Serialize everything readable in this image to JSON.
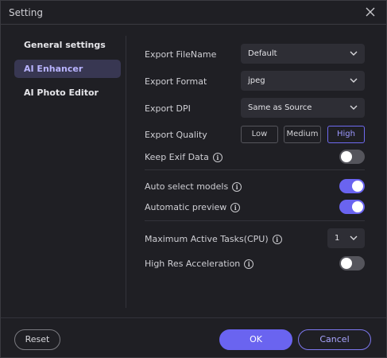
{
  "window": {
    "title": "Setting"
  },
  "sidebar": {
    "items": [
      {
        "label": "General settings"
      },
      {
        "label": "AI Enhancer"
      },
      {
        "label": "AI Photo Editor"
      }
    ]
  },
  "settings": {
    "export_filename": {
      "label": "Export FileName",
      "value": "Default"
    },
    "export_format": {
      "label": "Export Format",
      "value": "jpeg"
    },
    "export_dpi": {
      "label": "Export DPI",
      "value": "Same as Source"
    },
    "export_quality": {
      "label": "Export Quality",
      "options": [
        "Low",
        "Medium",
        "High"
      ],
      "selected": "High"
    },
    "keep_exif": {
      "label": "Keep Exif Data",
      "enabled": false
    },
    "auto_select_models": {
      "label": "Auto select models",
      "enabled": true
    },
    "automatic_preview": {
      "label": "Automatic preview",
      "enabled": true
    },
    "max_active_tasks": {
      "label": "Maximum Active Tasks(CPU)",
      "value": "1"
    },
    "high_res_acceleration": {
      "label": "High Res Acceleration",
      "enabled": false
    }
  },
  "footer": {
    "reset_label": "Reset",
    "ok_label": "OK",
    "cancel_label": "Cancel"
  },
  "colors": {
    "accent": "#6a64f0",
    "background": "#1f1f24",
    "active_item_bg": "#383752"
  }
}
